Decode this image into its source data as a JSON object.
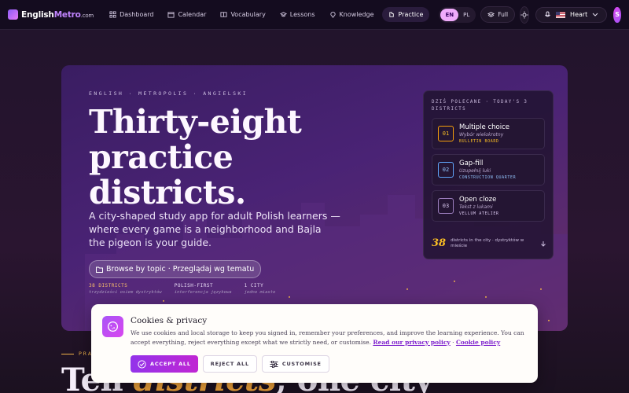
{
  "nav": {
    "logo_a": "English",
    "logo_b": "Metro",
    "logo_c": ".com",
    "items": [
      {
        "label": "Dashboard",
        "icon": "grid-icon"
      },
      {
        "label": "Calendar",
        "icon": "calendar-icon"
      },
      {
        "label": "Vocabulary",
        "icon": "book-icon"
      },
      {
        "label": "Lessons",
        "icon": "graduation-icon"
      },
      {
        "label": "Knowledge",
        "icon": "bulb-icon"
      },
      {
        "label": "Practice",
        "icon": "puzzle-icon",
        "active": true
      }
    ],
    "lang_en": "EN",
    "lang_pl": "PL",
    "full": "Full",
    "voice": "Heart",
    "avatar": "S"
  },
  "hero": {
    "eyebrow": "ENGLISH · METROPOLIS · ANGIELSKI",
    "headline": "Thirty-eight practice districts.",
    "sub": "A city-shaped study app for adult Polish learners — where every game is a neighborhood and Bajla the pigeon is your guide.",
    "browse": "Browse by topic · Przeglądaj wg tematu",
    "stats": [
      {
        "label": "38 DISTRICTS",
        "sub": "trzydzieści osiem dystryktów"
      },
      {
        "label": "POLISH-FIRST",
        "sub": "interferencja językowa"
      },
      {
        "label": "1 CITY",
        "sub": "jedno miasto"
      }
    ]
  },
  "card": {
    "title": "DZIŚ POLECANE · TODAY'S 3 DISTRICTS",
    "items": [
      {
        "num": "01",
        "title": "Multiple choice",
        "pl": "Wybór wielokrotny",
        "tag": "BULLETIN BOARD"
      },
      {
        "num": "02",
        "title": "Gap-fill",
        "pl": "Uzupełnij luki",
        "tag": "CONSTRUCTION QUARTER"
      },
      {
        "num": "03",
        "title": "Open cloze",
        "pl": "Tekst z lukami",
        "tag": "VELLUM ATELIER"
      }
    ],
    "foot_num": "38",
    "foot_text": "districts in the city · dystryktów w mieście"
  },
  "lower": {
    "eyebrow": "PRA",
    "heading_a": "Ten ",
    "heading_b": "districts",
    "heading_c": ", one city"
  },
  "cookie": {
    "title": "Cookies & privacy",
    "body": "We use cookies and local storage to keep you signed in, remember your preferences, and improve the learning experience. You can accept everything, reject everything except what we strictly need, or customise.",
    "privacy": "Read our privacy policy",
    "sep": " · ",
    "cookie_policy": "Cookie policy",
    "accept": "ACCEPT ALL",
    "reject": "REJECT ALL",
    "customise": "CUSTOMISE"
  }
}
